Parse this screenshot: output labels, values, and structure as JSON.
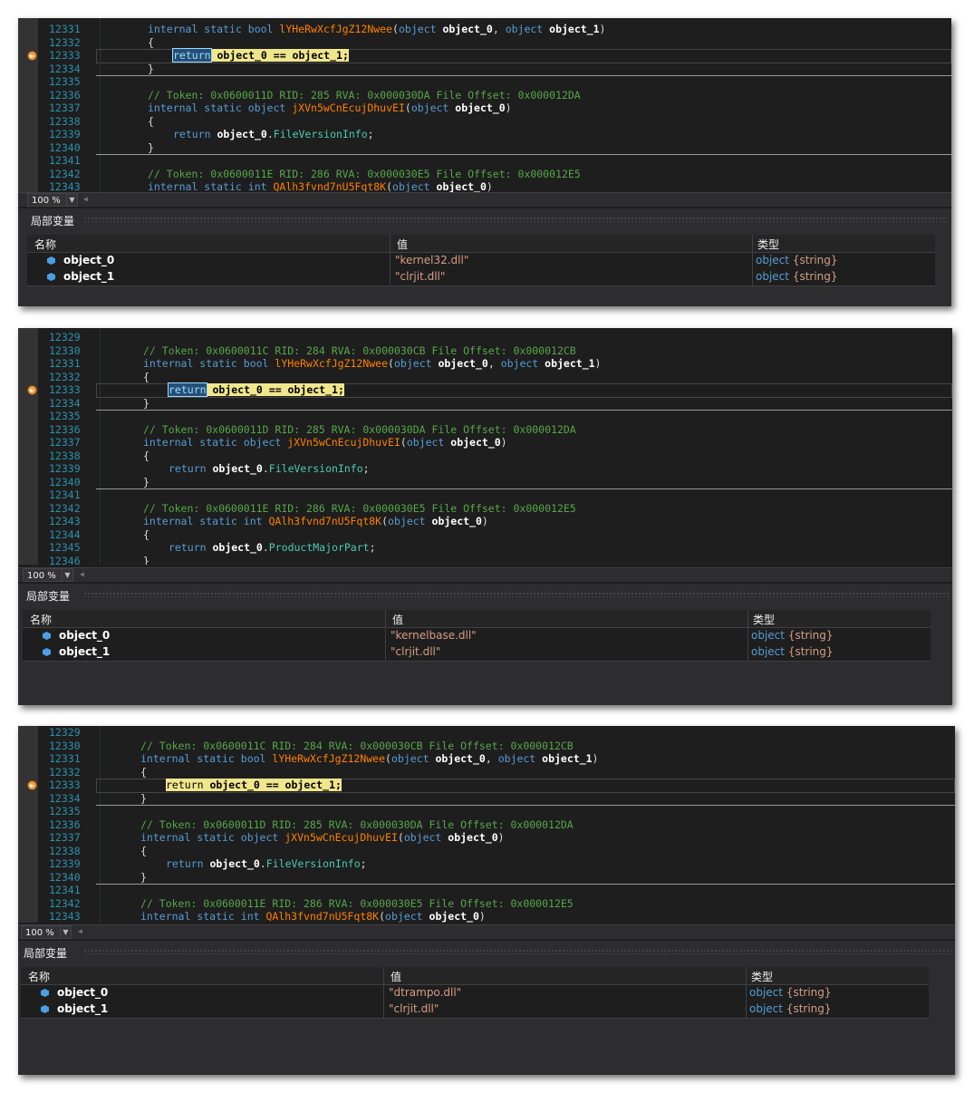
{
  "panels": [
    {
      "lines": [
        {
          "n": "12331",
          "type": "sig",
          "mod": "internal static bool ",
          "name": "lYHeRwXcfJgZ12Nwee",
          "args": "object_0, object_1"
        },
        {
          "n": "12332",
          "type": "brace",
          "text": "{"
        },
        {
          "n": "12333",
          "type": "ret",
          "text": "return object_0 == object_1;"
        },
        {
          "n": "12334",
          "type": "brace",
          "text": "}"
        },
        {
          "n": "12335",
          "type": "blank"
        },
        {
          "n": "12336",
          "type": "comment",
          "text": "// Token: 0x0600011D RID: 285 RVA: 0x000030DA File Offset: 0x000012DA"
        },
        {
          "n": "12337",
          "type": "sig1",
          "mod": "internal static object ",
          "name": "jXVn5wCnEcujDhuvEI",
          "args": "object_0"
        },
        {
          "n": "12338",
          "type": "brace",
          "text": "{"
        },
        {
          "n": "12339",
          "type": "retprop",
          "prop": "FileVersionInfo"
        },
        {
          "n": "12340",
          "type": "brace",
          "text": "}"
        },
        {
          "n": "12341",
          "type": "blank"
        },
        {
          "n": "12342",
          "type": "comment",
          "text": "// Token: 0x0600011E RID: 286 RVA: 0x000030E5 File Offset: 0x000012E5"
        },
        {
          "n": "12343",
          "type": "sig1",
          "mod": "internal static int ",
          "name": "QAlh3fvnd7nU5Fqt8K",
          "args": "object_0"
        }
      ],
      "zoom": "100 %",
      "locals_title": "局部变量",
      "headers": {
        "name": "名称",
        "value": "值",
        "type": "类型"
      },
      "vars": [
        {
          "name": "object_0",
          "value": "\"kernel32.dll\"",
          "type_obj": "object",
          "type_inner": "{string}"
        },
        {
          "name": "object_1",
          "value": "\"clrjit.dll\"",
          "type_obj": "object",
          "type_inner": "{string}"
        }
      ]
    },
    {
      "lines": [
        {
          "n": "12329",
          "type": "blank"
        },
        {
          "n": "12330",
          "type": "comment",
          "text": "// Token: 0x0600011C RID: 284 RVA: 0x000030CB File Offset: 0x000012CB"
        },
        {
          "n": "12331",
          "type": "sig",
          "mod": "internal static bool ",
          "name": "lYHeRwXcfJgZ12Nwee",
          "args": "object_0, object_1"
        },
        {
          "n": "12332",
          "type": "brace",
          "text": "{"
        },
        {
          "n": "12333",
          "type": "ret",
          "text": "return object_0 == object_1;"
        },
        {
          "n": "12334",
          "type": "brace",
          "text": "}"
        },
        {
          "n": "12335",
          "type": "blank"
        },
        {
          "n": "12336",
          "type": "comment",
          "text": "// Token: 0x0600011D RID: 285 RVA: 0x000030DA File Offset: 0x000012DA"
        },
        {
          "n": "12337",
          "type": "sig1",
          "mod": "internal static object ",
          "name": "jXVn5wCnEcujDhuvEI",
          "args": "object_0"
        },
        {
          "n": "12338",
          "type": "brace",
          "text": "{"
        },
        {
          "n": "12339",
          "type": "retprop",
          "prop": "FileVersionInfo"
        },
        {
          "n": "12340",
          "type": "brace",
          "text": "}"
        },
        {
          "n": "12341",
          "type": "blank"
        },
        {
          "n": "12342",
          "type": "comment",
          "text": "// Token: 0x0600011E RID: 286 RVA: 0x000030E5 File Offset: 0x000012E5"
        },
        {
          "n": "12343",
          "type": "sig1",
          "mod": "internal static int ",
          "name": "QAlh3fvnd7nU5Fqt8K",
          "args": "object_0"
        },
        {
          "n": "12344",
          "type": "brace",
          "text": "{"
        },
        {
          "n": "12345",
          "type": "retprop",
          "prop": "ProductMajorPart"
        },
        {
          "n": "12346",
          "type": "brace",
          "text": "}"
        }
      ],
      "zoom": "100 %",
      "locals_title": "局部变量",
      "headers": {
        "name": "名称",
        "value": "值",
        "type": "类型"
      },
      "vars": [
        {
          "name": "object_0",
          "value": "\"kernelbase.dll\"",
          "type_obj": "object",
          "type_inner": "{string}"
        },
        {
          "name": "object_1",
          "value": "\"clrjit.dll\"",
          "type_obj": "object",
          "type_inner": "{string}"
        }
      ]
    },
    {
      "lines": [
        {
          "n": "12329",
          "type": "blank"
        },
        {
          "n": "12330",
          "type": "comment",
          "text": "// Token: 0x0600011C RID: 284 RVA: 0x000030CB File Offset: 0x000012CB"
        },
        {
          "n": "12331",
          "type": "sig",
          "mod": "internal static bool ",
          "name": "lYHeRwXcfJgZ12Nwee",
          "args": "object_0, object_1"
        },
        {
          "n": "12332",
          "type": "brace",
          "text": "{"
        },
        {
          "n": "12333",
          "type": "ret",
          "text": "return object_0 == object_1;"
        },
        {
          "n": "12334",
          "type": "brace",
          "text": "}"
        },
        {
          "n": "12335",
          "type": "blank"
        },
        {
          "n": "12336",
          "type": "comment",
          "text": "// Token: 0x0600011D RID: 285 RVA: 0x000030DA File Offset: 0x000012DA"
        },
        {
          "n": "12337",
          "type": "sig1",
          "mod": "internal static object ",
          "name": "jXVn5wCnEcujDhuvEI",
          "args": "object_0"
        },
        {
          "n": "12338",
          "type": "brace",
          "text": "{"
        },
        {
          "n": "12339",
          "type": "retprop",
          "prop": "FileVersionInfo"
        },
        {
          "n": "12340",
          "type": "brace",
          "text": "}"
        },
        {
          "n": "12341",
          "type": "blank"
        },
        {
          "n": "12342",
          "type": "comment",
          "text": "// Token: 0x0600011E RID: 286 RVA: 0x000030E5 File Offset: 0x000012E5"
        },
        {
          "n": "12343",
          "type": "sig1",
          "mod": "internal static int ",
          "name": "QAlh3fvnd7nU5Fqt8K",
          "args": "object_0"
        }
      ],
      "zoom": "100 %",
      "locals_title": "局部变量",
      "headers": {
        "name": "名称",
        "value": "值",
        "type": "类型"
      },
      "vars": [
        {
          "name": "object_0",
          "value": "\"dtrampo.dll\"",
          "type_obj": "object",
          "type_inner": "{string}"
        },
        {
          "name": "object_1",
          "value": "\"clrjit.dll\"",
          "type_obj": "object",
          "type_inner": "{string}"
        }
      ]
    }
  ]
}
